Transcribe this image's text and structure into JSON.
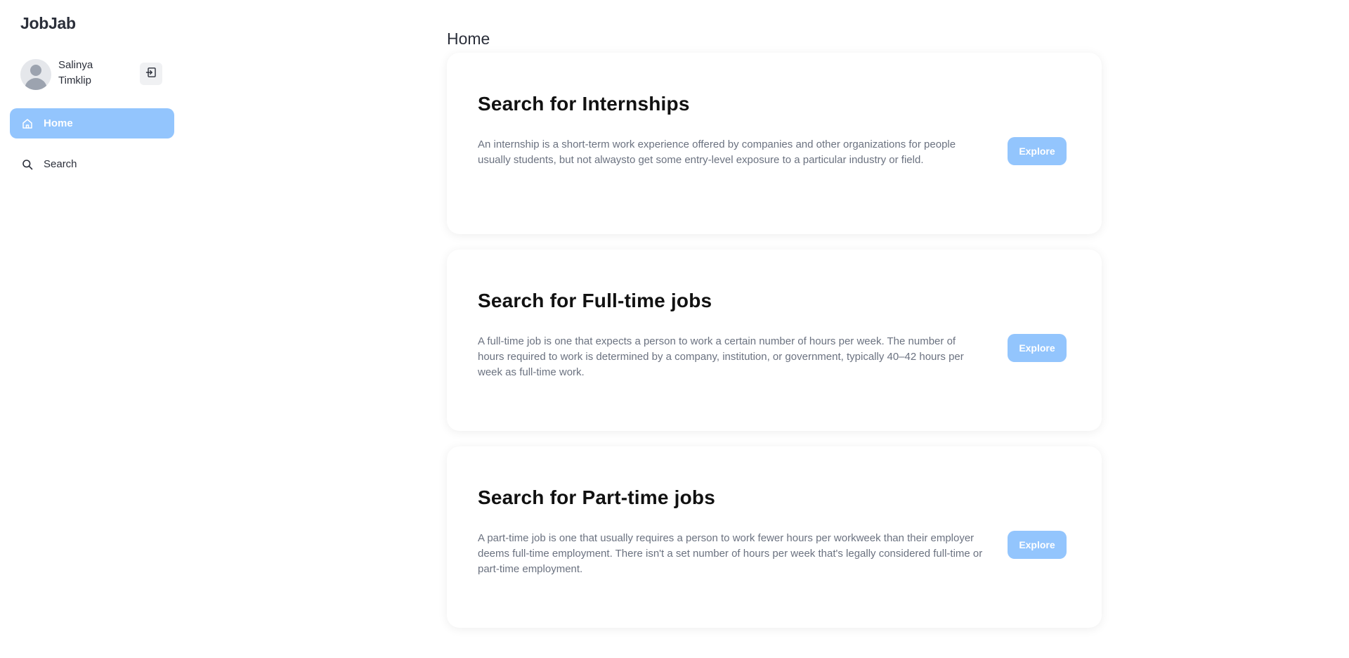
{
  "app": {
    "logo": "JobJab"
  },
  "user": {
    "first_name": "Salinya",
    "last_name": "Timklip",
    "logout_icon": "logout-icon"
  },
  "sidebar": {
    "items": [
      {
        "label": "Home",
        "icon": "home-icon",
        "active": true
      },
      {
        "label": "Search",
        "icon": "search-icon",
        "active": false
      }
    ]
  },
  "main": {
    "title": "Home",
    "cards": [
      {
        "title": "Search for Internships",
        "description": "An internship is a short-term work experience offered by companies and other organizations for people usually students, but not alwaysto get some entry-level exposure to a particular industry or field.",
        "button": "Explore"
      },
      {
        "title": "Search for Full-time jobs",
        "description": "A full-time job is one that expects a person to work a certain number of hours per week. The number of hours required to work is determined by a company, institution, or government, typically 40–42 hours per week as full-time work.",
        "button": "Explore"
      },
      {
        "title": "Search for Part-time jobs",
        "description": "A part-time job is one that usually requires a person to work fewer hours per workweek than their employer deems full-time employment. There isn't a set number of hours per week that's legally considered full-time or part-time employment.",
        "button": "Explore"
      }
    ]
  },
  "colors": {
    "accent": "#93c5fd",
    "text_dark": "#2b2f3a",
    "text_muted": "#6b7280"
  }
}
